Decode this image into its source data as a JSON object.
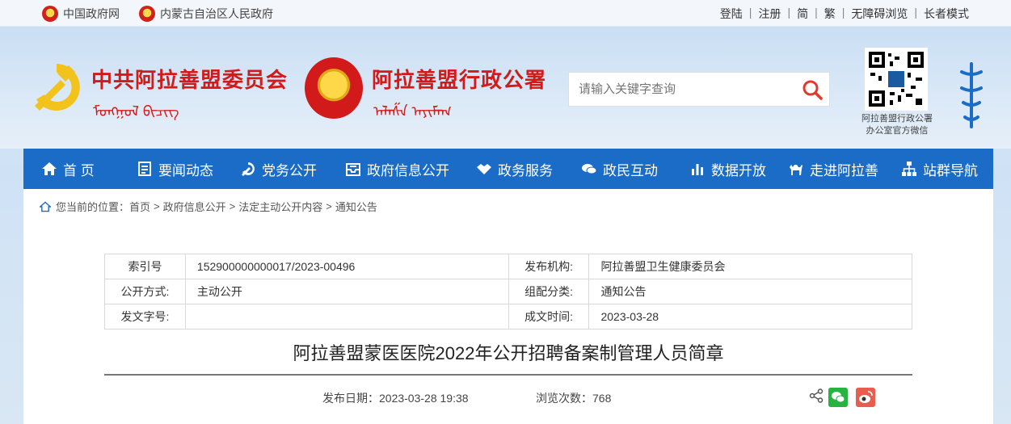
{
  "topbar": {
    "left_links": [
      "中国政府网",
      "内蒙古自治区人民政府"
    ],
    "right_links": [
      "登陆",
      "注册",
      "简",
      "繁",
      "无障碍浏览",
      "长者模式"
    ]
  },
  "header": {
    "party_title": "中共阿拉善盟委员会",
    "gov_title": "阿拉善盟行政公署",
    "search_placeholder": "请输入关键字查询",
    "qr_caption_line1": "阿拉善盟行政公署",
    "qr_caption_line2": "办公室官方微信"
  },
  "nav": {
    "items": [
      "首 页",
      "要闻动态",
      "党务公开",
      "政府信息公开",
      "政务服务",
      "政民互动",
      "数据开放",
      "走进阿拉善",
      "站群导航"
    ]
  },
  "breadcrumb": {
    "prefix": "您当前的位置：",
    "items": [
      "首页",
      "政府信息公开",
      "法定主动公开内容",
      "通知公告"
    ]
  },
  "meta_table": {
    "rows": [
      {
        "l1": "索引号",
        "v1": "152900000000017/2023-00496",
        "l2": "发布机构:",
        "v2": "阿拉善盟卫生健康委员会"
      },
      {
        "l1": "公开方式:",
        "v1": "主动公开",
        "l2": "组配分类:",
        "v2": "通知公告"
      },
      {
        "l1": "发文字号:",
        "v1": "",
        "l2": "成文时间:",
        "v2": "2023-03-28"
      }
    ]
  },
  "article": {
    "title": "阿拉善盟蒙医医院2022年公开招聘备案制管理人员简章",
    "publish_label": "发布日期：",
    "publish_date": "2023-03-28 19:38",
    "views_label": "浏览次数：",
    "views": "768"
  },
  "colors": {
    "nav_blue": "#1a6cc7",
    "title_red": "#d21a1a"
  }
}
